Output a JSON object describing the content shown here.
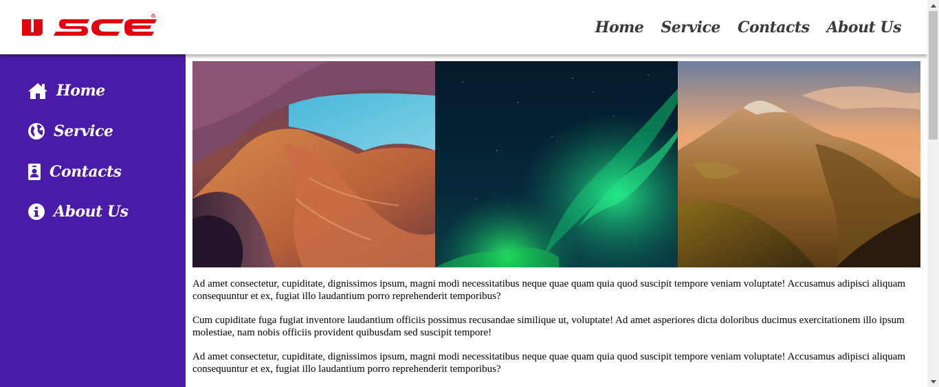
{
  "brand": {
    "logo_text": "IJSE",
    "logo_color": "#e3000f"
  },
  "topnav": {
    "items": [
      {
        "label": "Home"
      },
      {
        "label": "Service"
      },
      {
        "label": "Contacts"
      },
      {
        "label": "About Us"
      }
    ]
  },
  "sidebar": {
    "bg_color": "#4a1aa8",
    "items": [
      {
        "label": "Home",
        "icon": "home-icon"
      },
      {
        "label": "Service",
        "icon": "globe-icon"
      },
      {
        "label": "Contacts",
        "icon": "id-badge-icon"
      },
      {
        "label": "About Us",
        "icon": "info-circle-icon"
      }
    ]
  },
  "gallery": {
    "images": [
      {
        "subject": "canyon"
      },
      {
        "subject": "aurora"
      },
      {
        "subject": "mountain"
      }
    ]
  },
  "content": {
    "paragraphs": [
      "Ad amet consectetur, cupiditate, dignissimos ipsum, magni modi necessitatibus neque quae quam quia quod suscipit tempore veniam voluptate! Accusamus adipisci aliquam consequuntur et ex, fugiat illo laudantium porro reprehenderit temporibus?",
      "Cum cupiditate fuga fugiat inventore laudantium officiis possimus recusandae similique ut, voluptate! Ad amet asperiores dicta doloribus ducimus exercitationem illo ipsum molestiae, nam nobis officiis provident quibusdam sed suscipit tempore!",
      "Ad amet consectetur, cupiditate, dignissimos ipsum, magni modi necessitatibus neque quae quam quia quod suscipit tempore veniam voluptate! Accusamus adipisci aliquam consequuntur et ex, fugiat illo laudantium porro reprehenderit temporibus?"
    ]
  }
}
